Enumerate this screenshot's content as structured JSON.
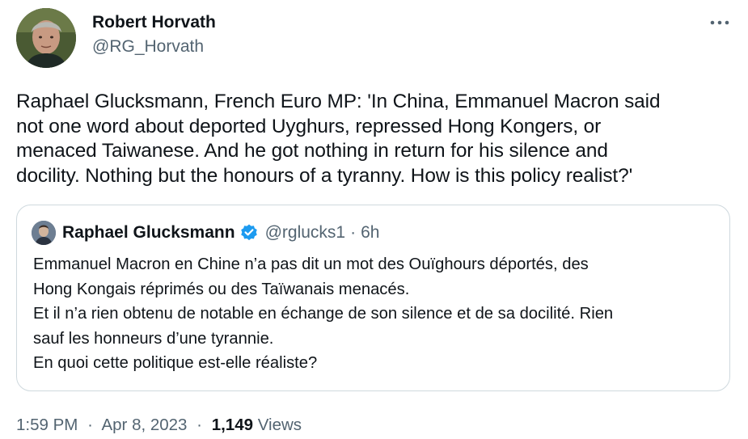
{
  "author": {
    "name": "Robert Horvath",
    "handle": "@RG_Horvath"
  },
  "tweet": {
    "text": "Raphael Glucksmann, French Euro MP: 'In China, Emmanuel Macron said\nnot one word about deported Uyghurs, repressed Hong Kongers, or\nmenaced Taiwanese. And he got nothing in return for his silence and\ndocility. Nothing but the honours of a tyranny. How is this policy realist?'"
  },
  "quote": {
    "name": "Raphael Glucksmann",
    "handle": "@rglucks1",
    "separator": "·",
    "time": "6h",
    "text": "Emmanuel Macron en Chine n’a pas dit un mot des Ouïghours déportés, des\nHong Kongais réprimés ou des Taïwanais menacés.\nEt il n’a rien obtenu de notable en échange de son silence et de sa docilité. Rien\nsauf les honneurs d’une tyrannie.\nEn quoi cette politique est-elle réaliste?"
  },
  "meta": {
    "time": "1:59 PM",
    "separator": "·",
    "date": "Apr 8, 2023",
    "views_count": "1,149",
    "views_label": "Views"
  },
  "colors": {
    "text": "#0f1419",
    "secondary": "#536471",
    "border": "#cfd9de",
    "verified": "#1d9bf0"
  },
  "icons": {
    "more": "more-horizontal-icon",
    "verified": "verified-badge-icon"
  }
}
